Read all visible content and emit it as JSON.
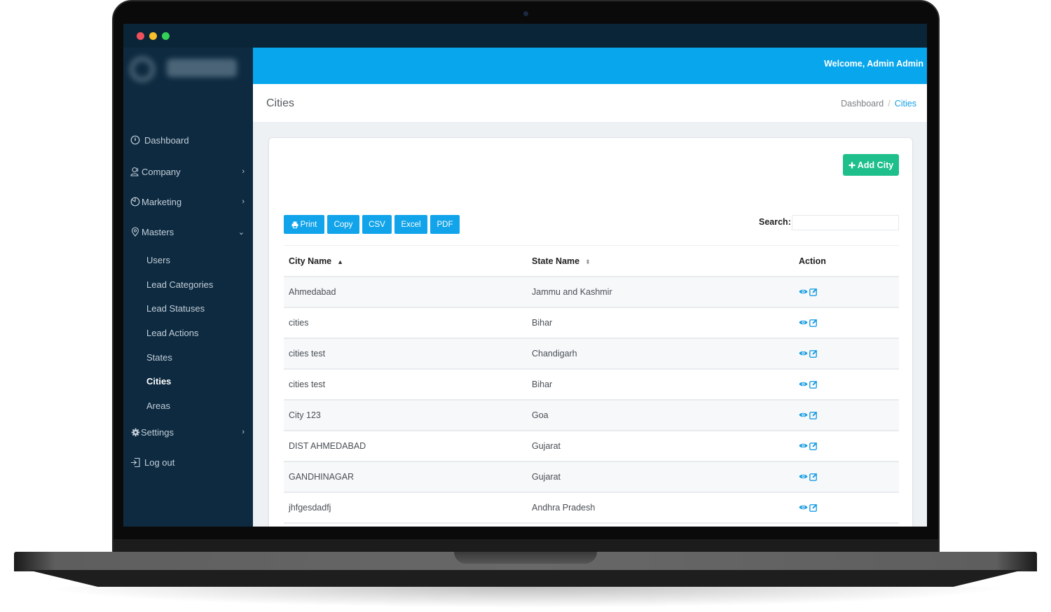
{
  "window": {
    "controls": [
      "close",
      "minimize",
      "maximize"
    ]
  },
  "topbar": {
    "welcome": "Welcome, Admin Admin"
  },
  "page": {
    "title": "Cities",
    "breadcrumb": [
      {
        "label": "Dashboard"
      },
      {
        "label": "Cities"
      }
    ],
    "breadcrumb_separator": "/"
  },
  "sidebar": {
    "items": [
      {
        "label": "Dashboard",
        "icon": "dashboard-icon"
      },
      {
        "label": "Company",
        "icon": "user-group-icon",
        "chevron": "›"
      },
      {
        "label": "Marketing",
        "icon": "pie-chart-icon",
        "chevron": "›"
      },
      {
        "label": "Masters",
        "icon": "map-pin-icon",
        "chevron": "⌄"
      },
      {
        "label": "Settings",
        "icon": "gear-icon",
        "chevron": "›"
      },
      {
        "label": "Log out",
        "icon": "logout-icon"
      }
    ],
    "masters_sub": [
      {
        "label": "Users"
      },
      {
        "label": "Lead Categories"
      },
      {
        "label": "Lead Statuses"
      },
      {
        "label": "Lead Actions"
      },
      {
        "label": "States"
      },
      {
        "label": "Cities",
        "active": true
      },
      {
        "label": "Areas"
      }
    ]
  },
  "toolbar": {
    "add_label": "Add City",
    "export_buttons": [
      "Print",
      "Copy",
      "CSV",
      "Excel",
      "PDF"
    ],
    "search_label": "Search:",
    "search_value": ""
  },
  "table": {
    "columns": [
      {
        "label": "City Name",
        "sort": "asc"
      },
      {
        "label": "State Name",
        "sort": "both"
      },
      {
        "label": "Action"
      }
    ],
    "rows": [
      {
        "city": "Ahmedabad",
        "state": "Jammu and Kashmir"
      },
      {
        "city": "cities",
        "state": "Bihar"
      },
      {
        "city": "cities test",
        "state": "Chandigarh"
      },
      {
        "city": "cities test",
        "state": "Bihar"
      },
      {
        "city": "City 123",
        "state": "Goa"
      },
      {
        "city": "DIST AHMEDABAD",
        "state": "Gujarat"
      },
      {
        "city": "GANDHINAGAR",
        "state": "Gujarat"
      },
      {
        "city": "jhfgesdadfj",
        "state": "Andhra Pradesh"
      }
    ]
  },
  "colors": {
    "sidebar_bg": "#0d2a40",
    "topbar_accent": "#08a6ec",
    "add_button": "#1ebf8a",
    "export_button": "#12a4ea",
    "action_icon": "#1a9ce2"
  }
}
